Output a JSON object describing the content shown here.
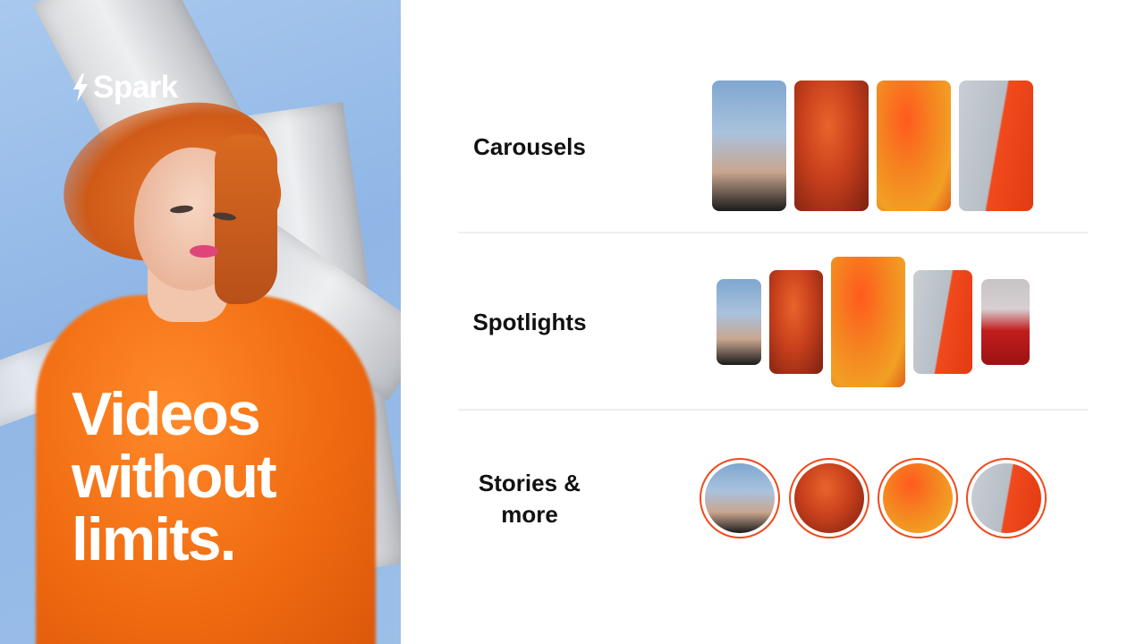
{
  "brand": {
    "name": "Spark"
  },
  "hero": {
    "headline": [
      "Videos",
      "without",
      "limits."
    ]
  },
  "sections": [
    {
      "label_lines": [
        "Carousels"
      ],
      "thumb_icons": [
        "photo-woman-blonde",
        "photo-woman-red",
        "photo-woman-orange",
        "photo-woman-split"
      ]
    },
    {
      "label_lines": [
        "Spotlights"
      ],
      "thumb_icons": [
        "photo-woman-blonde",
        "photo-woman-red",
        "photo-woman-orange",
        "photo-woman-split",
        "photo-woman-dress"
      ]
    },
    {
      "label_lines": [
        "Stories &",
        "more"
      ],
      "thumb_icons": [
        "photo-woman-blonde",
        "photo-woman-red",
        "photo-woman-orange",
        "photo-woman-split"
      ]
    }
  ],
  "colors": {
    "accent": "#f04a1d",
    "text": "#111111",
    "background": "#ffffff",
    "divider": "#eeeeee"
  }
}
